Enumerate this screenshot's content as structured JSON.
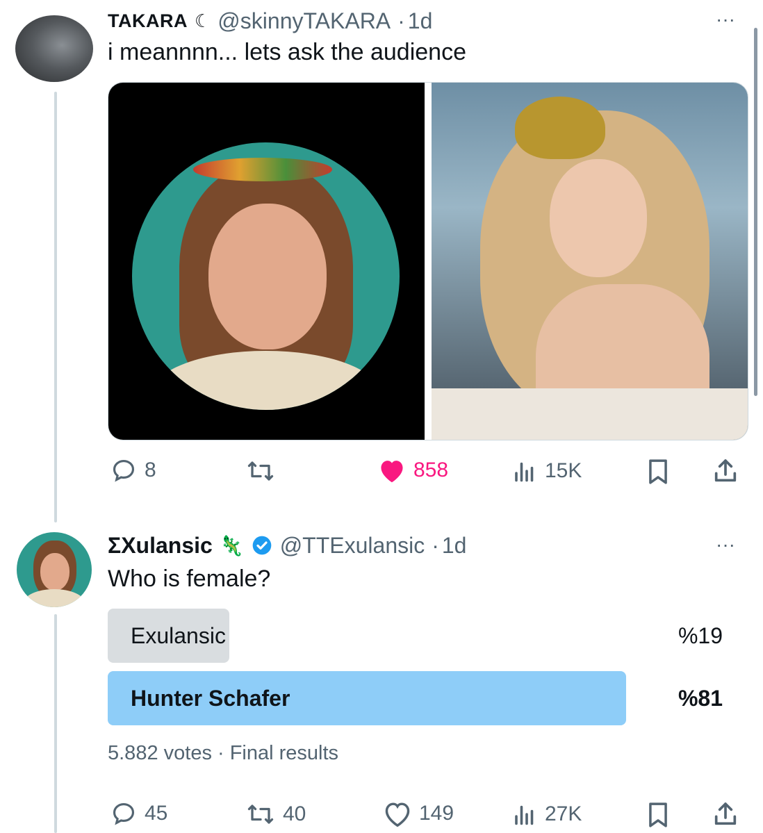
{
  "tweet1": {
    "display_name": "TAKARA",
    "name_icon": "moon-icon",
    "handle": "@skinnyTAKARA",
    "separator": "·",
    "time": "1d",
    "text": "i meannnn... lets ask the audience",
    "actions": {
      "replies": "8",
      "retweets": "",
      "likes": "858",
      "views": "15K"
    },
    "like_color": "#f91880"
  },
  "tweet2": {
    "display_name": "ΣXulansic",
    "name_emoji": "🦎",
    "verified_color": "#1d9bf0",
    "handle": "@TTExulansic",
    "separator": "·",
    "time": "1d",
    "text": "Who is female?",
    "poll": {
      "options": [
        {
          "label": "Exulansic",
          "percent_text": "%19",
          "fraction": 0.19,
          "winner": false
        },
        {
          "label": "Hunter Schafer",
          "percent_text": "%81",
          "fraction": 0.81,
          "winner": true
        }
      ],
      "footer": "5.882 votes · Final results",
      "winner_color": "#8ecdf8",
      "loser_color": "#cfd9de"
    },
    "actions": {
      "replies": "45",
      "retweets": "40",
      "likes": "149",
      "views": "27K"
    }
  },
  "more_label": "···"
}
